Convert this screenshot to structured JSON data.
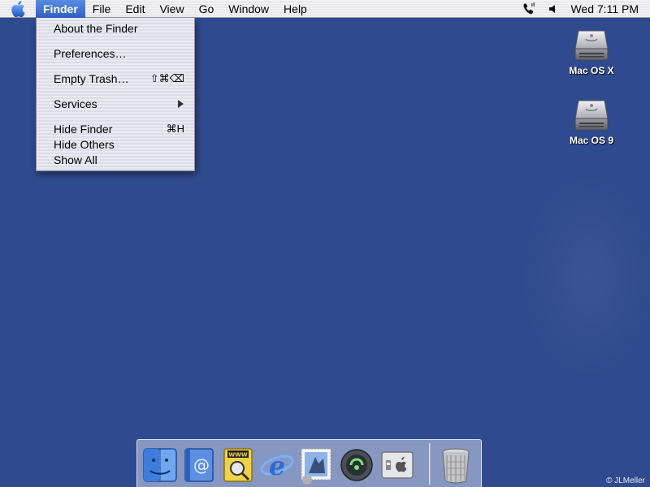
{
  "menubar": {
    "app_name": "Finder",
    "menus": [
      "File",
      "Edit",
      "View",
      "Go",
      "Window",
      "Help"
    ],
    "clock": "Wed 7:11 PM",
    "status_icons": [
      "phone-modem-icon",
      "speaker-volume-icon"
    ]
  },
  "finder_menu": {
    "items": [
      {
        "label": "About the Finder",
        "shortcut": ""
      },
      {
        "label": "Preferences…",
        "shortcut": ""
      },
      {
        "label": "Empty Trash…",
        "shortcut": "⇧⌘⌫"
      },
      {
        "label": "Services",
        "shortcut": "",
        "has_submenu": true
      },
      {
        "label": "Hide Finder",
        "shortcut": "⌘H"
      },
      {
        "label": "Hide Others",
        "shortcut": ""
      },
      {
        "label": "Show All",
        "shortcut": ""
      }
    ]
  },
  "desktop": {
    "icons": [
      {
        "label": "Mac OS X",
        "icon": "hard-drive-icon"
      },
      {
        "label": "Mac OS 9",
        "icon": "hard-drive-icon"
      }
    ],
    "background_color": "#2f4a8e"
  },
  "dock": {
    "items": [
      "finder-icon",
      "mail-icon",
      "sherlock-icon",
      "internet-explorer-icon",
      "mail-stamp-icon",
      "quicktime-icon",
      "system-preferences-icon",
      "trash-icon"
    ]
  },
  "credit": "© JLMeller",
  "colors": {
    "menu_highlight": "#2f62c8",
    "menu_bg": "#ecebf2"
  }
}
